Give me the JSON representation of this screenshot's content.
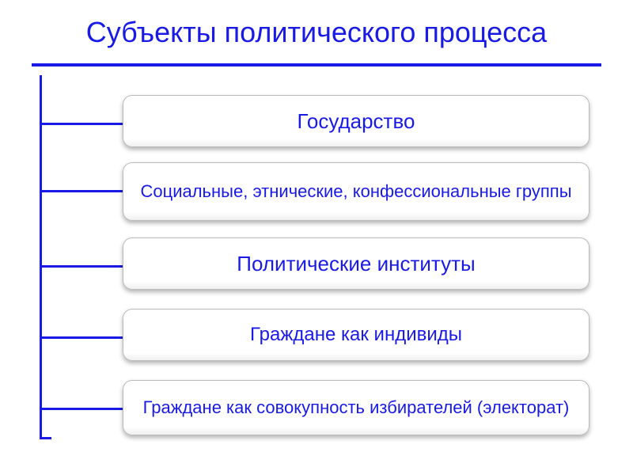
{
  "title": "Субъекты политического процесса",
  "items": [
    {
      "label": "Государство"
    },
    {
      "label": "Социальные, этнические, конфессиональные группы"
    },
    {
      "label": "Политические институты"
    },
    {
      "label": "Граждане как индивиды"
    },
    {
      "label": "Граждане как совокупность избирателей (электорат)"
    }
  ],
  "colors": {
    "primary": "#1a1ae6",
    "background": "#ffffff"
  }
}
